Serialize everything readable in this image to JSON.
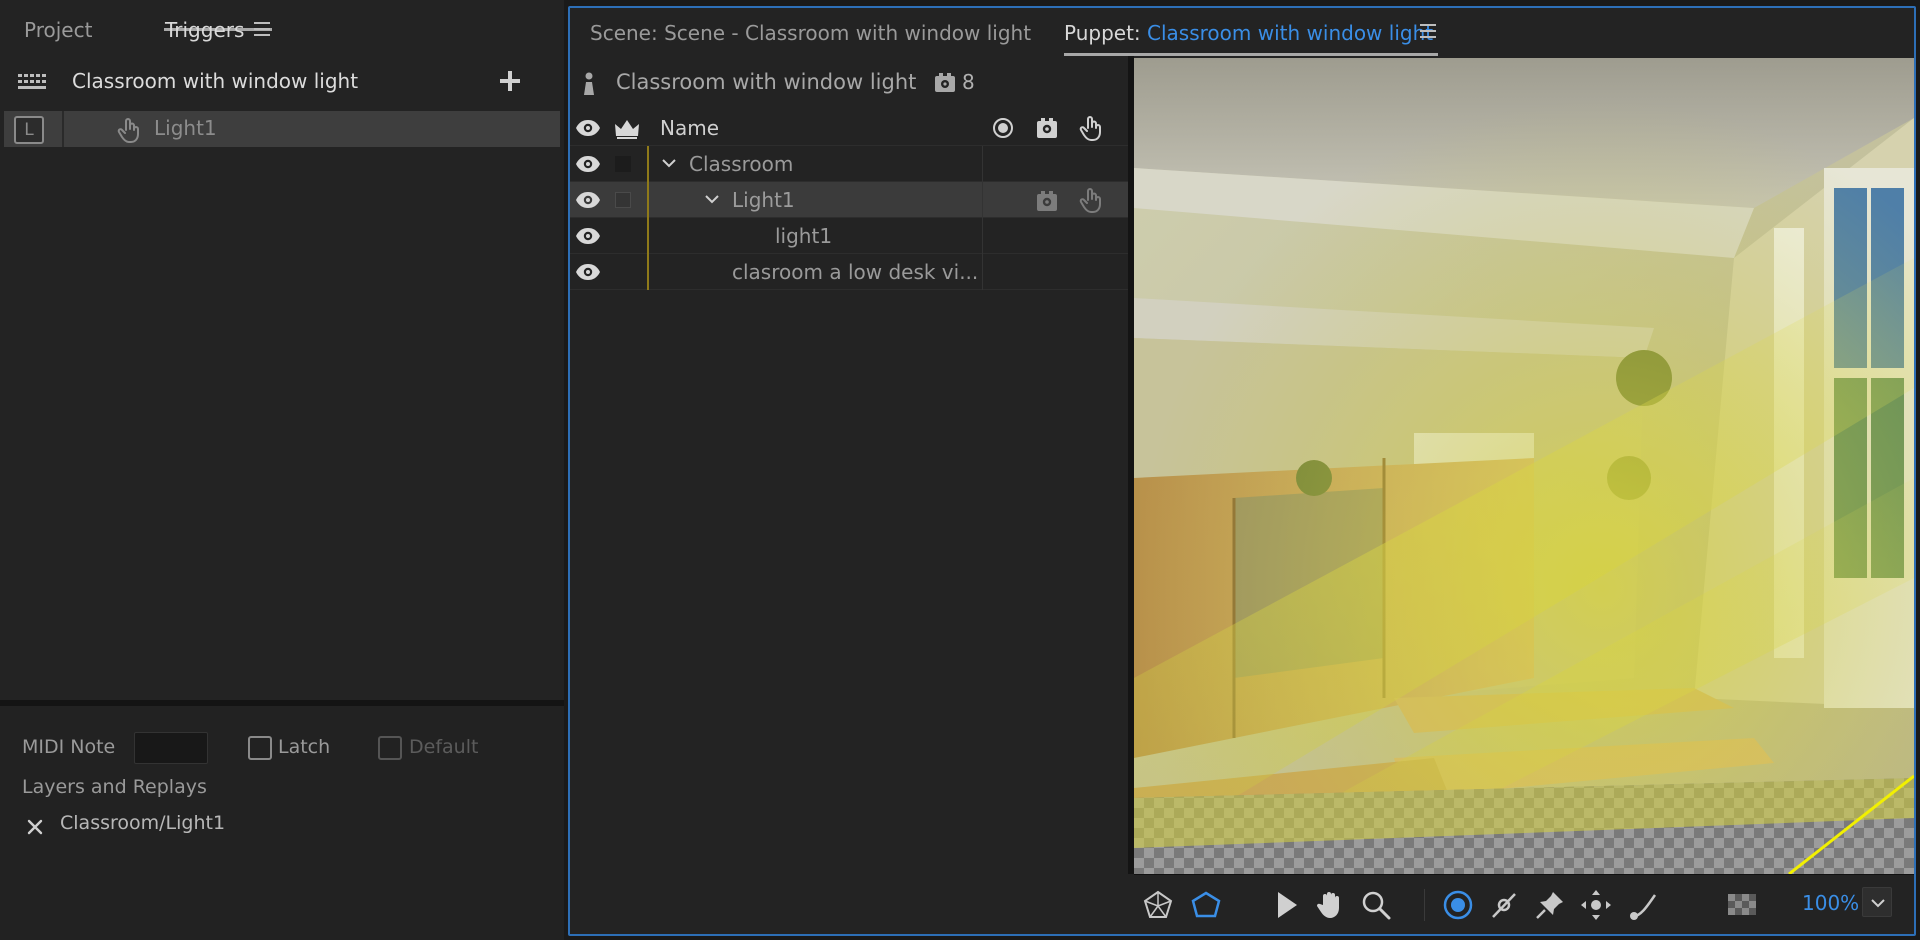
{
  "left_panel": {
    "tabs": {
      "project": "Project",
      "triggers": "Triggers"
    },
    "puppet_name": "Classroom with window light",
    "trigger": {
      "key": "L",
      "name": "Light1"
    },
    "midi_note_label": "MIDI Note",
    "midi_note_value": "",
    "latch_label": "Latch",
    "default_label": "Default",
    "layers_replays_label": "Layers and Replays",
    "layer_entry": "Classroom/Light1"
  },
  "right_panel": {
    "scene_tab": "Scene: Scene - Classroom with window light",
    "puppet_tab_prefix": "Puppet: ",
    "puppet_tab_name": "Classroom with window light",
    "rig": {
      "puppet_title": "Classroom with window light",
      "behavior_count": "8",
      "name_header": "Name",
      "layers": [
        {
          "name": "Classroom",
          "level": 0,
          "expanded": true
        },
        {
          "name": "Light1",
          "level": 1,
          "expanded": true,
          "selected": true
        },
        {
          "name": "light1",
          "level": 2
        },
        {
          "name": "clasroom a low desk vi...",
          "level": 1
        }
      ]
    },
    "viewer": {
      "zoom": "100%"
    }
  },
  "colors": {
    "accent": "#3a8ee6",
    "panel_bg": "#232323",
    "selected_row": "#3b3b3b",
    "focus_border": "#2d6fb7",
    "guide_yellow": "#8f7a1a"
  },
  "icons": [
    "menu-icon",
    "grid-icon",
    "plus-icon",
    "hand-icon",
    "eye-icon",
    "crown-icon",
    "record-icon",
    "behavior-icon",
    "person-icon",
    "chevron-down-icon",
    "close-icon",
    "mesh-icon",
    "polygon-icon",
    "select-arrow-icon",
    "pan-hand-icon",
    "zoom-icon",
    "origin-icon",
    "stick-icon",
    "pin-icon",
    "handle-icon",
    "dragger-icon",
    "transparency-grid-icon"
  ]
}
